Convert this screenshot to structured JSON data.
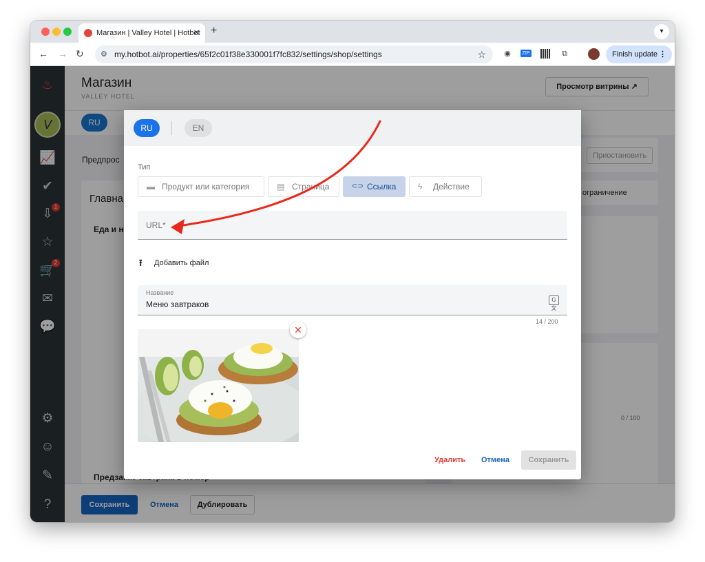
{
  "browser": {
    "tab_title": "Магазин | Valley Hotel | Hotbot",
    "tab_close": "✕",
    "new_tab": "+",
    "url": "my.hotbot.ai/properties/65f2c01f38e330001f7fc832/settings/shop/settings",
    "finish_update": "Finish update",
    "zip_label": "ZIP"
  },
  "sidebar": {
    "badges": {
      "inbox": "1",
      "cart": "2"
    },
    "brand_letter": "V"
  },
  "page": {
    "title": "Магазин",
    "subtitle": "VALLEY HOTEL",
    "storefront_button": "Просмотр витрины ↗",
    "lang_ru": "RU",
    "bg_preview": "Предпрос",
    "bg_suspend": "Приостановить",
    "bg_main": "Главна",
    "bg_limit": "ограничение",
    "bg_food": "Еда и н",
    "bg_counter": "0 / 100",
    "bg_bottom_text": "Предзаказ завтрака в номер",
    "save": "Сохранить",
    "cancel": "Отмена",
    "duplicate": "Дублировать"
  },
  "modal": {
    "lang_ru": "RU",
    "lang_en": "EN",
    "type_label": "Тип",
    "types": [
      {
        "label": "Продукт или категория",
        "icon": "store-icon",
        "glyph": "▬"
      },
      {
        "label": "Страница",
        "icon": "document-icon",
        "glyph": "▤"
      },
      {
        "label": "Ссылка",
        "icon": "link-icon",
        "glyph": "⊂⊃"
      },
      {
        "label": "Действие",
        "icon": "flash-icon",
        "glyph": "ϟ"
      }
    ],
    "active_type": "Ссылка",
    "url_placeholder": "URL*",
    "add_file": "Добавить файл",
    "name_label": "Название",
    "name_value": "Меню завтраков",
    "name_counter": "14 / 200",
    "remove_glyph": "✕",
    "delete": "Удалить",
    "cancel": "Отмена",
    "save": "Сохранить"
  },
  "colors": {
    "primary": "#1a73e8",
    "sidebar": "#2a3238",
    "danger": "#e53935",
    "active_type_bg": "#c7d3e8",
    "annotation_arrow": "#e8291c"
  }
}
